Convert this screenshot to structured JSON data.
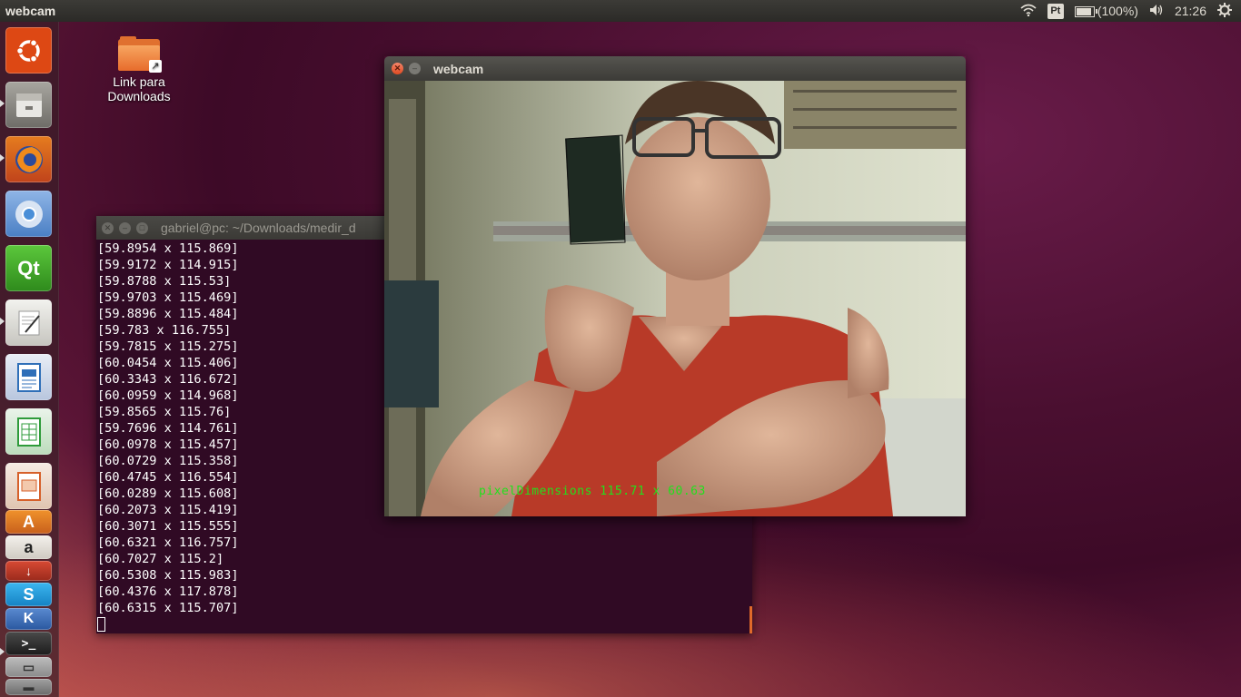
{
  "top_panel": {
    "app_title": "webcam",
    "keyboard_layout": "Pt",
    "battery_text": "(100%)",
    "clock": "21:26"
  },
  "launcher": {
    "items": [
      {
        "name": "ubuntu-dash",
        "color": "#dd4814",
        "glyph": "◉"
      },
      {
        "name": "files",
        "color": "#8e8c86",
        "glyph": "▤"
      },
      {
        "name": "firefox",
        "color": "#e66000",
        "glyph": "●"
      },
      {
        "name": "chromium",
        "color": "#4a8fd8",
        "glyph": "◎"
      },
      {
        "name": "qt-creator",
        "color": "#41a62a",
        "glyph": "Qt"
      },
      {
        "name": "text-editor",
        "color": "#d9d9d4",
        "glyph": "✎"
      },
      {
        "name": "writer",
        "color": "#2f6fb8",
        "glyph": "▦"
      },
      {
        "name": "calc",
        "color": "#2e9b3a",
        "glyph": "▦"
      },
      {
        "name": "impress",
        "color": "#d6602a",
        "glyph": "▦"
      },
      {
        "name": "software-center",
        "color": "#e07a24",
        "glyph": "A"
      },
      {
        "name": "amazon",
        "color": "#d8d3cc",
        "glyph": "a"
      },
      {
        "name": "updater",
        "color": "#b03a2a",
        "glyph": "↓"
      },
      {
        "name": "skype",
        "color": "#1ea0e0",
        "glyph": "S"
      },
      {
        "name": "kdevelop",
        "color": "#3a6fb8",
        "glyph": "K"
      },
      {
        "name": "terminal",
        "color": "#2c2c2c",
        "glyph": ">_"
      },
      {
        "name": "scanner",
        "color": "#9a9a9a",
        "glyph": "▭"
      },
      {
        "name": "trash",
        "color": "#7a7a7a",
        "glyph": "▬"
      }
    ]
  },
  "desktop": {
    "icon_label_line1": "Link para",
    "icon_label_line2": "Downloads"
  },
  "terminal": {
    "title": "gabriel@pc: ~/Downloads/medir_d",
    "lines": [
      "[59.8954 x 115.869]",
      "[59.9172 x 114.915]",
      "[59.8788 x 115.53]",
      "[59.9703 x 115.469]",
      "[59.8896 x 115.484]",
      "[59.783 x 116.755]",
      "[59.7815 x 115.275]",
      "[60.0454 x 115.406]",
      "[60.3343 x 116.672]",
      "[60.0959 x 114.968]",
      "[59.8565 x 115.76]",
      "[59.7696 x 114.761]",
      "[60.0978 x 115.457]",
      "[60.0729 x 115.358]",
      "[60.4745 x 116.554]",
      "[60.0289 x 115.608]",
      "[60.2073 x 115.419]",
      "[60.3071 x 115.555]",
      "[60.6321 x 116.757]",
      "[60.7027 x 115.2]",
      "[60.5308 x 115.983]",
      "[60.4376 x 117.878]",
      "[60.6315 x 115.707]"
    ]
  },
  "webcam": {
    "title": "webcam",
    "overlay_text": "pixelDimensions 115.71 x 60.63"
  }
}
